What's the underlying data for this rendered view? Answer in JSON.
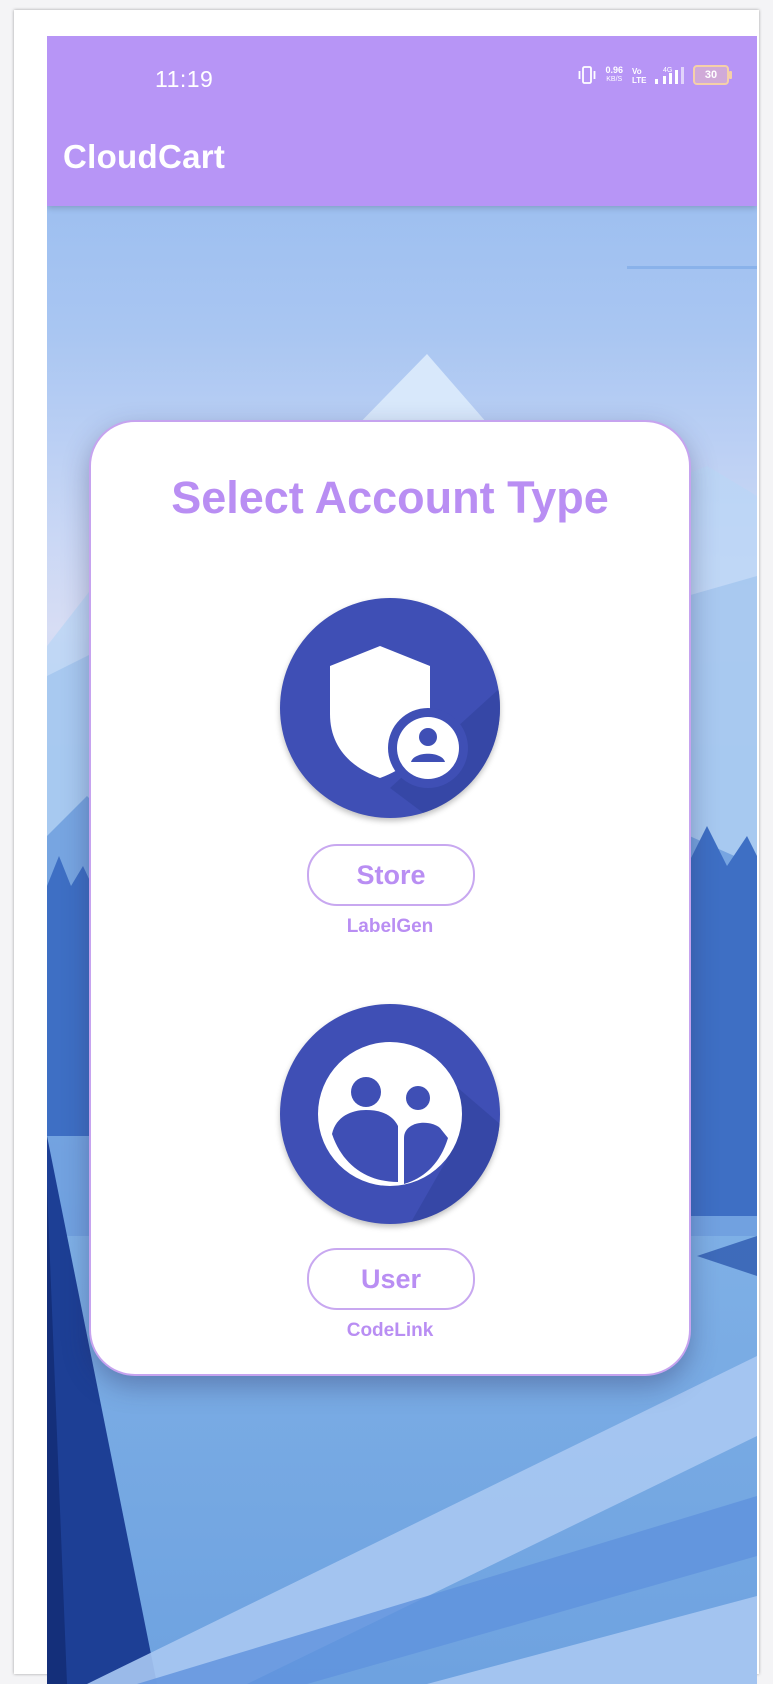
{
  "status_bar": {
    "time": "11:19",
    "net_speed": "0.96",
    "net_speed_unit": "KB/S",
    "battery": "30"
  },
  "app_bar": {
    "title": "CloudCart"
  },
  "card": {
    "title": "Select Account Type",
    "options": [
      {
        "label": "Store",
        "subtitle": "LabelGen",
        "icon": "admin-shield-icon"
      },
      {
        "label": "User",
        "subtitle": "CodeLink",
        "icon": "users-group-icon"
      }
    ]
  },
  "colors": {
    "accent": "#b795f6",
    "title_text": "#b98ef3",
    "icon_circle": "#3f4fb5",
    "card_border": "#c6a3ef"
  }
}
